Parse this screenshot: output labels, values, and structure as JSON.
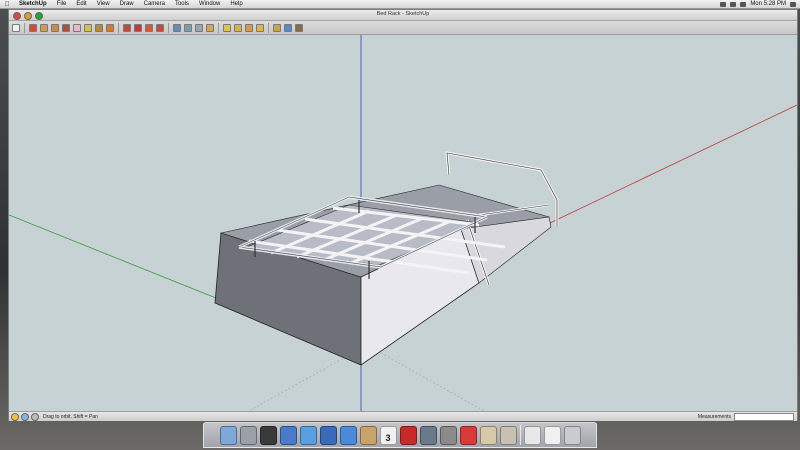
{
  "menubar": {
    "apple": "",
    "items": [
      "SketchUp",
      "File",
      "Edit",
      "View",
      "Draw",
      "Camera",
      "Tools",
      "Window",
      "Help"
    ],
    "clock": "Mon 5:28 PM"
  },
  "window": {
    "title": "Bed Rack - SketchUp"
  },
  "toolbar": {
    "tools": [
      {
        "icon": "select-arrow-icon",
        "color": "#f2f2f2"
      },
      {
        "icon": "pencil-line-icon",
        "color": "#d44a3a"
      },
      {
        "icon": "rectangle-icon",
        "color": "#c99b5a"
      },
      {
        "icon": "circle-icon",
        "color": "#c88a4a"
      },
      {
        "icon": "arc-icon",
        "color": "#b54a3a"
      },
      {
        "icon": "eraser-icon",
        "color": "#e7b8c8"
      },
      {
        "icon": "paint-bucket-icon",
        "color": "#d4c24a"
      },
      {
        "icon": "push-pull-icon",
        "color": "#b78a3a"
      },
      {
        "icon": "follow-me-icon",
        "color": "#d47a2a"
      },
      {
        "icon": "move-icon",
        "color": "#c24a3a"
      },
      {
        "icon": "rotate-icon",
        "color": "#c23a3a"
      },
      {
        "icon": "scale-icon",
        "color": "#d45a3a"
      },
      {
        "icon": "offset-icon",
        "color": "#c24a3a"
      },
      {
        "icon": "orbit-icon",
        "color": "#6a8ab4"
      },
      {
        "icon": "pan-icon",
        "color": "#7a9ab4"
      },
      {
        "icon": "zoom-icon",
        "color": "#9aa4ae"
      },
      {
        "icon": "zoom-extents-icon",
        "color": "#d4a84a"
      },
      {
        "icon": "previous-view-icon",
        "color": "#e0c24a"
      },
      {
        "icon": "next-view-icon",
        "color": "#d4b44a"
      },
      {
        "icon": "components-icon",
        "color": "#d49a4a"
      },
      {
        "icon": "materials-icon",
        "color": "#e0b44a"
      },
      {
        "icon": "warehouse-icon",
        "color": "#c8a44a"
      },
      {
        "icon": "share-model-icon",
        "color": "#5a8ac8"
      },
      {
        "icon": "extension-warehouse-icon",
        "color": "#8a6a4a"
      }
    ]
  },
  "statusbar": {
    "hint": "Drag to orbit.  Shift = Pan",
    "measurements_label": "Measurements",
    "measurements_value": ""
  },
  "viewport": {
    "background": "#c6d2d3",
    "axis_colors": {
      "red": "#c04040",
      "green": "#3a9a3a",
      "blue": "#3a3ac8"
    }
  },
  "dock": {
    "items": [
      {
        "icon": "finder-icon",
        "color": "#7fa8d8"
      },
      {
        "icon": "launchpad-icon",
        "color": "#9aa0a8"
      },
      {
        "icon": "dashboard-icon",
        "color": "#3a3a3a"
      },
      {
        "icon": "mail-icon",
        "color": "#4a7ac8"
      },
      {
        "icon": "safari-icon",
        "color": "#5aa0e0"
      },
      {
        "icon": "itunes-icon",
        "color": "#3a6ab8"
      },
      {
        "icon": "app-store-icon",
        "color": "#4a8ad8"
      },
      {
        "icon": "address-book-icon",
        "color": "#c8a46a"
      },
      {
        "icon": "calendar-icon",
        "color": "#f0f0f0",
        "text": "3"
      },
      {
        "icon": "photo-booth-icon",
        "color": "#c82a2a"
      },
      {
        "icon": "preview-icon",
        "color": "#6a7a8a"
      },
      {
        "icon": "system-preferences-icon",
        "color": "#8a8a8a"
      },
      {
        "icon": "sketchup-icon",
        "color": "#d83a3a"
      },
      {
        "icon": "documents-stack-icon",
        "color": "#d8c8a8"
      },
      {
        "icon": "utilities-icon",
        "color": "#c8c0b0"
      },
      {
        "icon": "pdf-document-icon",
        "color": "#e8e8e8"
      },
      {
        "icon": "text-document-icon",
        "color": "#f0f0f0"
      },
      {
        "icon": "trash-icon",
        "color": "#c8ccd0"
      }
    ]
  }
}
